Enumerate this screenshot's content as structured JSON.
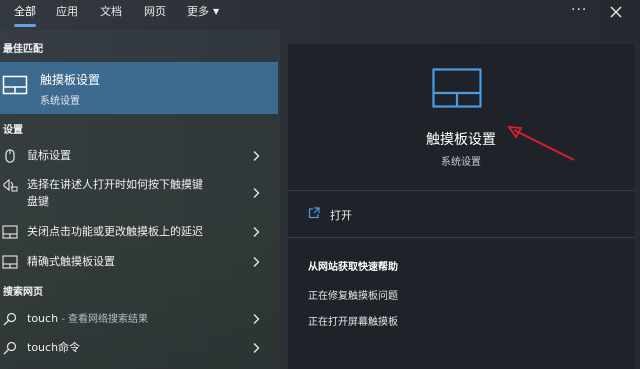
{
  "tabs": [
    {
      "label": "全部",
      "active": true
    },
    {
      "label": "应用"
    },
    {
      "label": "文档"
    },
    {
      "label": "网页"
    },
    {
      "label": "更多"
    }
  ],
  "topbar": {
    "more_options": "···"
  },
  "left": {
    "best_match_header": "最佳匹配",
    "best_match": {
      "title": "触摸板设置",
      "subtitle": "系统设置",
      "icon": "touchpad-icon"
    },
    "settings_header": "设置",
    "settings_items": [
      {
        "label": "鼠标设置",
        "icon": "mouse-icon"
      },
      {
        "label_line1": "选择在讲述人打开时如何按下触摸键",
        "label_line2": "盘键",
        "icon": "narrator-icon"
      },
      {
        "label": "关闭点击功能或更改触摸板上的延迟",
        "icon": "touchpad-icon"
      },
      {
        "label": "精确式触摸板设置",
        "icon": "touchpad-icon"
      }
    ],
    "web_header": "搜索网页",
    "web_items": [
      {
        "label": "touch",
        "hint": " - 查看网络搜索结果",
        "icon": "search-icon"
      },
      {
        "label": "touch命令",
        "icon": "search-icon"
      }
    ]
  },
  "right": {
    "title": "触摸板设置",
    "subtitle": "系统设置",
    "open_label": "打开",
    "help_title": "从网站获取快速帮助",
    "help_links": [
      "正在修复触摸板问题",
      "正在打开屏幕触摸板"
    ]
  },
  "colors": {
    "accent": "#5aa3e6",
    "selection": "#3d6a8f",
    "annotation_arrow": "#d8202a"
  }
}
